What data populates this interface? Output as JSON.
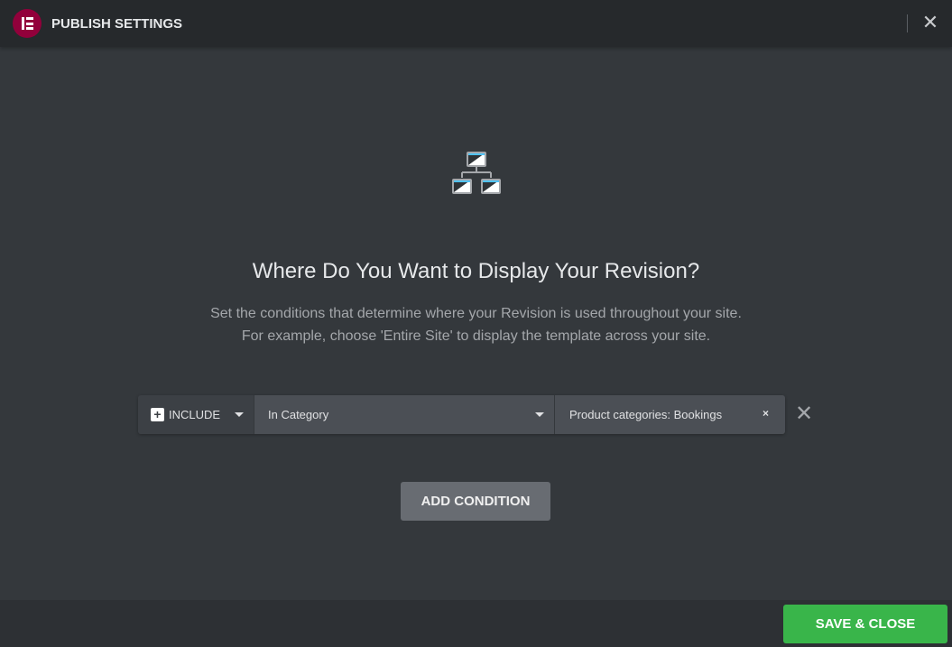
{
  "header": {
    "title": "PUBLISH SETTINGS",
    "logo": "elementor-logo",
    "close_icon": "close-icon"
  },
  "main": {
    "icon": "sitemap-icon",
    "heading": "Where Do You Want to Display Your Revision?",
    "description_line1": "Set the conditions that determine where your Revision is used throughout your site.",
    "description_line2": "For example, choose 'Entire Site' to display the template across your site.",
    "condition": {
      "type": "INCLUDE",
      "rule": "In Category",
      "value": "Product categories: Bookings",
      "value_remove": "×",
      "row_remove": "✕"
    },
    "add_condition_label": "ADD CONDITION"
  },
  "footer": {
    "save_label": "SAVE & CLOSE"
  },
  "colors": {
    "brand": "#92003b",
    "save": "#39b54a",
    "accent": "#4fc3f7"
  }
}
